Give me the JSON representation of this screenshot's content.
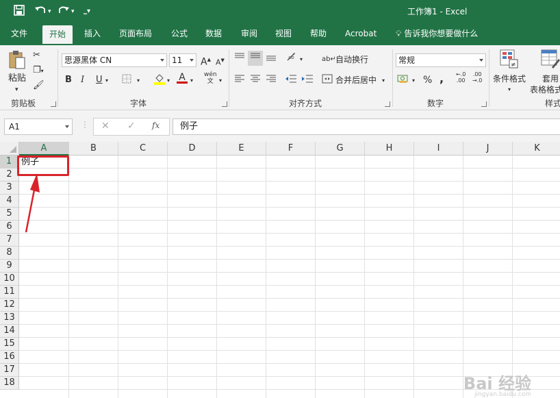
{
  "window": {
    "title": "工作簿1  -  Excel"
  },
  "tabs": [
    {
      "label": "文件"
    },
    {
      "label": "开始"
    },
    {
      "label": "插入"
    },
    {
      "label": "页面布局"
    },
    {
      "label": "公式"
    },
    {
      "label": "数据"
    },
    {
      "label": "审阅"
    },
    {
      "label": "视图"
    },
    {
      "label": "帮助"
    },
    {
      "label": "Acrobat"
    },
    {
      "label": "告诉我你想要做什么"
    }
  ],
  "ribbon": {
    "clipboard": {
      "paste_label": "粘贴",
      "group_label": "剪贴板"
    },
    "font": {
      "font_name": "思源黑体 CN",
      "font_size": "11",
      "bold": "B",
      "italic": "I",
      "underline": "U",
      "group_label": "字体",
      "grow": "A",
      "shrink": "A",
      "wen": "wén"
    },
    "alignment": {
      "wrap_label": "自动换行",
      "merge_label": "合并后居中",
      "group_label": "对齐方式"
    },
    "number": {
      "format": "常规",
      "percent": "%",
      "comma": ",",
      "inc_dec": ".00",
      "dec_dec": ".0",
      "group_label": "数字"
    },
    "styles": {
      "conditional_label": "条件格式",
      "table_label_1": "套用",
      "table_label_2": "表格格式",
      "group_label": "样式"
    }
  },
  "formula_bar": {
    "name_box": "A1",
    "cancel": "✕",
    "enter": "✓",
    "fx": "fx",
    "value": "例子"
  },
  "columns": [
    "A",
    "B",
    "C",
    "D",
    "E",
    "F",
    "G",
    "H",
    "I",
    "J",
    "K"
  ],
  "rows": [
    "1",
    "2",
    "3",
    "4",
    "5",
    "6",
    "7",
    "8",
    "9",
    "10",
    "11",
    "12",
    "13",
    "14",
    "15",
    "16",
    "17",
    "18"
  ],
  "cells": {
    "A1": "例子"
  },
  "watermark": {
    "main": "Bai 经验",
    "sub": "jingyan.baidu.com"
  }
}
